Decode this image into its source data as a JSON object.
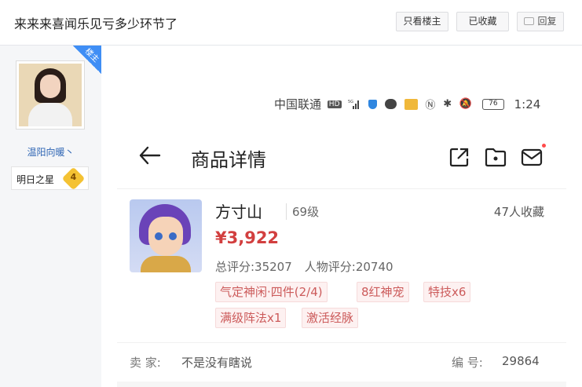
{
  "thread": {
    "title": "来来来喜闻乐见亏多少环节了",
    "buttons": {
      "only_owner": "只看楼主",
      "favorited": "已收藏",
      "reply": "回复"
    }
  },
  "author": {
    "badge": "楼主",
    "name": "温阳向暖丶",
    "level_title": "明日之星",
    "level": "4"
  },
  "phone_status": {
    "carrier": "中国联通",
    "hd": "HD",
    "network": "5G",
    "battery": "76",
    "time": "1:24"
  },
  "app_nav": {
    "title": "商品详情"
  },
  "item": {
    "name": "方寸山",
    "level": "69级",
    "favorites": "47人收藏",
    "price": "¥3,922",
    "total_score": "总评分:35207",
    "role_score": "人物评分:20740",
    "tags": [
      "气定神闲·四件(2/4)",
      "8红神宠",
      "特技x6",
      "满级阵法x1",
      "激活经脉"
    ]
  },
  "seller": {
    "seller_label": "卖  家:",
    "seller_name": "不是没有瞎说",
    "serial_label": "编  号:",
    "serial_value": "29864"
  },
  "colors": {
    "price": "#d23f3f",
    "tag_text": "#cc5b5b",
    "badge": "#3f8ef5",
    "link": "#2d64b3"
  }
}
